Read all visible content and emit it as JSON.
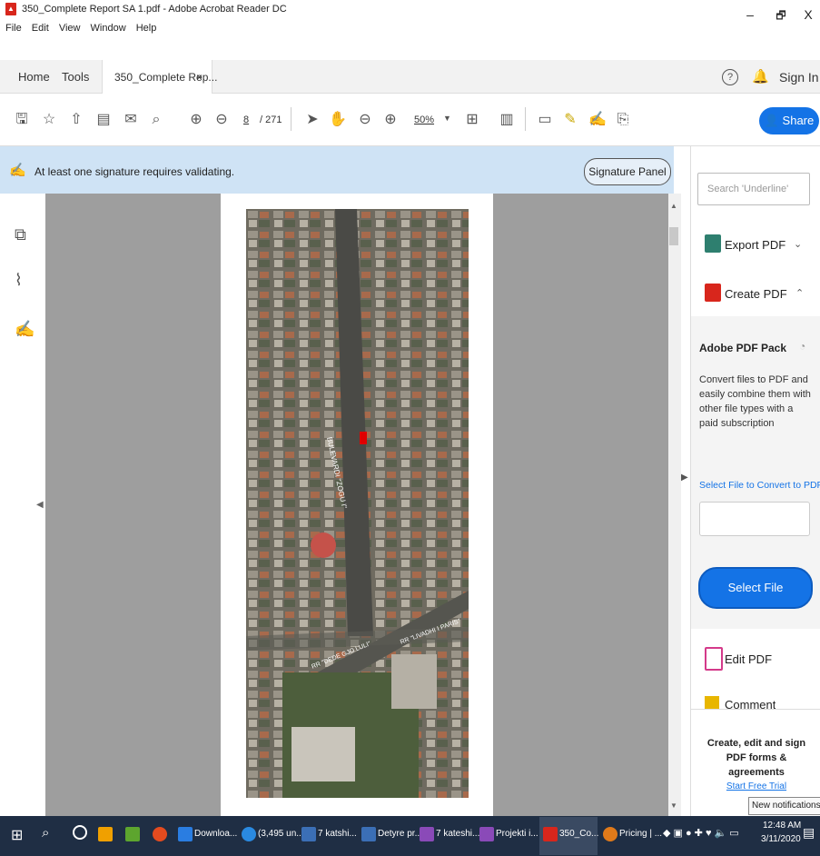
{
  "window": {
    "title": "350_Complete Report SA 1.pdf - Adobe Acrobat Reader DC",
    "menu": [
      "File",
      "Edit",
      "View",
      "Window",
      "Help"
    ],
    "controls": {
      "minimize": "–",
      "restore": "🗗",
      "close": "X"
    }
  },
  "tabs": {
    "home": "Home",
    "tools": "Tools",
    "document": "350_Complete Rep...",
    "close": "×",
    "sign_in": "Sign In"
  },
  "toolbar": {
    "page_current": "8",
    "page_total": "/ 271",
    "zoom": "50%",
    "share": "Share"
  },
  "signature_bar": {
    "message": "At least one signature requires validating.",
    "panel_button": "Signature Panel"
  },
  "map": {
    "labels": [
      "BULEVARDI \"ZOGU I\"",
      "RR \"LIVADHI I PARIS\"",
      "RR \"DEDE GJO LULI\""
    ]
  },
  "right_pane": {
    "search_placeholder": "Search 'Underline'",
    "export_pdf": "Export PDF",
    "create_pdf": "Create PDF",
    "pack_title": "Adobe PDF Pack",
    "pack_description": "Convert files to PDF and easily combine them with other file types with a paid subscription",
    "select_link": "Select File to Convert to PDF",
    "select_button": "Select File",
    "edit_pdf": "Edit PDF",
    "comment": "Comment",
    "promo": "Create, edit and sign PDF forms & agreements",
    "trial": "Start Free Trial"
  },
  "taskbar": {
    "items": [
      "Downloa...",
      "(3,495 un...",
      "7 katshi...",
      "Detyre pr...",
      "7 kateshi...",
      "Projekti i...",
      "350_Co...",
      "Pricing | ..."
    ],
    "time": "12:48 AM",
    "date": "3/11/2020",
    "notification": "New notifications (Of"
  },
  "colors": {
    "accent": "#1473e6",
    "signature_bar": "#cfe3f5",
    "taskbar": "#1f2e44"
  }
}
